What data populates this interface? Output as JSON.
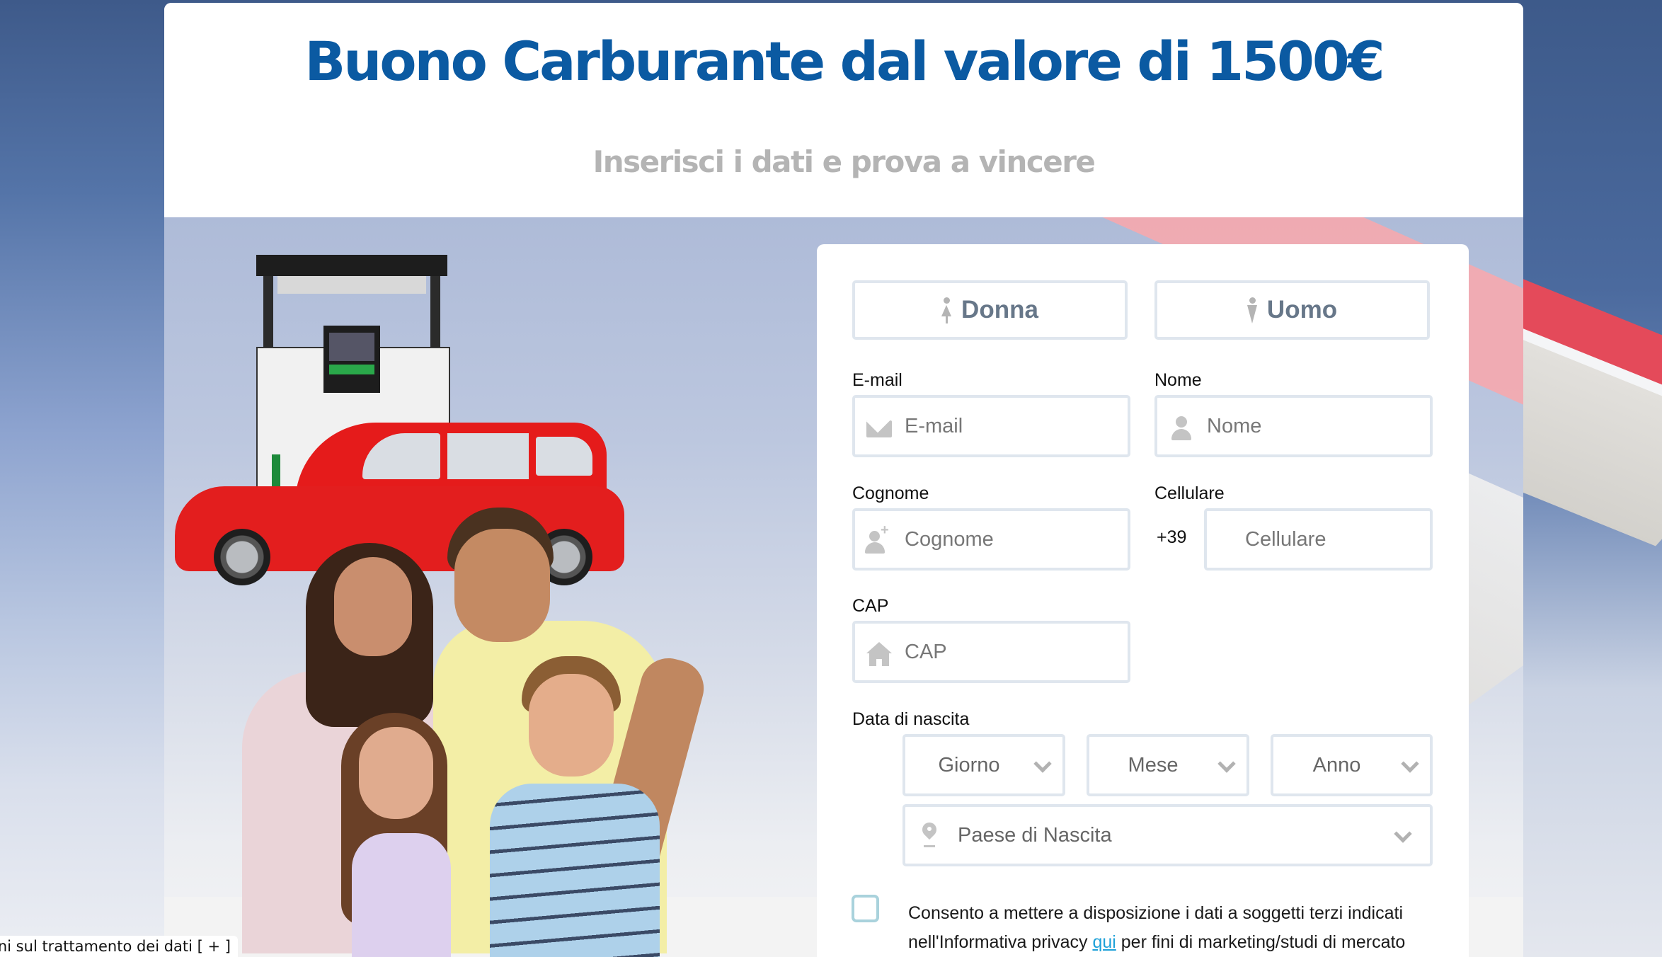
{
  "header": {
    "title": "Buono Carburante dal valore di 1500€",
    "subtitle": "Inserisci i dati e prova a vincere"
  },
  "colors": {
    "title": "#0b5aa2",
    "subtitle": "#b4b4b4",
    "field_border": "#dfe6ee",
    "gender_text": "#677789",
    "checkbox_border": "#a9d2dc",
    "link": "#1ea1d8"
  },
  "form": {
    "gender": [
      {
        "label": "Donna",
        "icon": "female-icon"
      },
      {
        "label": "Uomo",
        "icon": "male-icon"
      }
    ],
    "email": {
      "label": "E-mail",
      "placeholder": "E-mail",
      "value": "",
      "icon": "envelope-icon"
    },
    "nome": {
      "label": "Nome",
      "placeholder": "Nome",
      "value": "",
      "icon": "user-icon"
    },
    "cognome": {
      "label": "Cognome",
      "placeholder": "Cognome",
      "value": "",
      "icon": "user-plus-icon"
    },
    "cellulare": {
      "label": "Cellulare",
      "prefix": "+39",
      "placeholder": "Cellulare",
      "value": ""
    },
    "cap": {
      "label": "CAP",
      "placeholder": "CAP",
      "value": "",
      "icon": "home-icon"
    },
    "birth": {
      "label": "Data di nascita",
      "giorno": "Giorno",
      "mese": "Mese",
      "anno": "Anno"
    },
    "paese": {
      "placeholder": "Paese di Nascita",
      "icon": "map-pin-icon"
    },
    "consent": {
      "checked": false,
      "text_before": "Consento a mettere a disposizione i dati a soggetti terzi indicati nell'Informativa privacy ",
      "link_text": "qui",
      "text_after": " per fini di marketing/studi di mercato"
    }
  },
  "footer_tab": {
    "text": "Informazioni sul trattamento dei dati [ + ]"
  }
}
